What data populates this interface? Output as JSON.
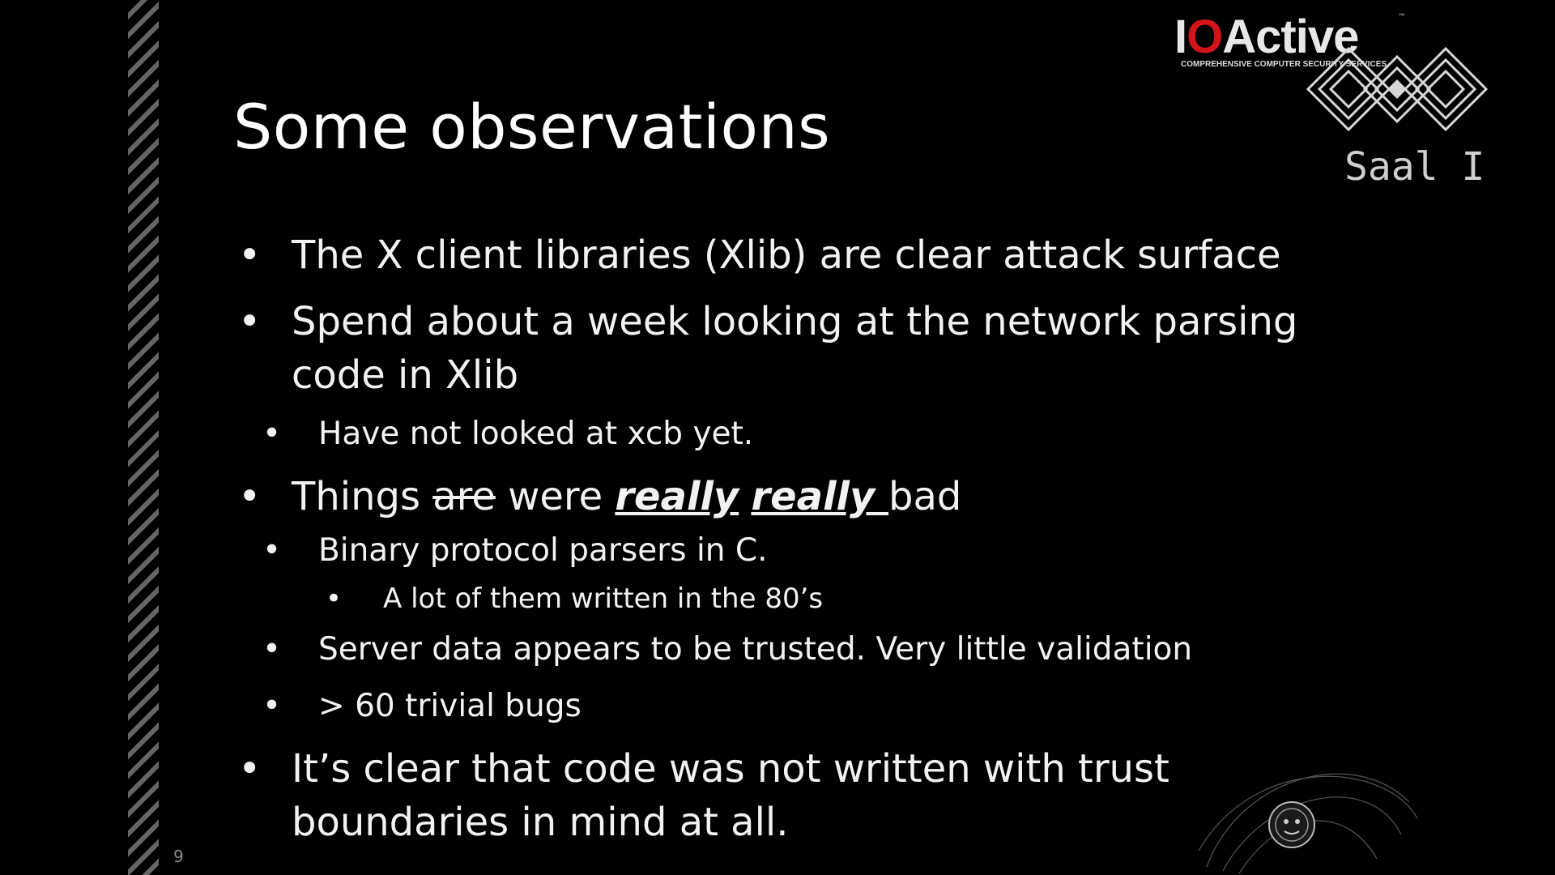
{
  "slide": {
    "title": "Some observations",
    "number": "9"
  },
  "logo": {
    "brand_prefix": "I",
    "brand_o": "O",
    "brand_suffix": "Active",
    "trademark": "™",
    "tagline": "COMPREHENSIVE COMPUTER SECURITY SERVICES"
  },
  "event": {
    "room": "Saal I"
  },
  "bullets": {
    "b1": "The X client libraries (Xlib) are clear attack surface",
    "b2_line1": "Spend about a week looking at the network parsing",
    "b2_line2": "code in Xlib",
    "b2_sub": "Have not looked at xcb yet.",
    "b3": {
      "prefix": "Things ",
      "struck": "are",
      "middle": " were ",
      "emph1": "really",
      "emph2": "really ",
      "suffix": "bad"
    },
    "b3_sub1": "Binary protocol parsers in C.",
    "b3_sub1_sub": "A lot of them written in the 80’s",
    "b3_sub2": "Server data appears to be trusted. Very little validation",
    "b3_sub3": "> 60 trivial bugs",
    "b4_line1": "It’s clear that code was not written with trust",
    "b4_line2": "boundaries in mind at all.",
    "bullet_glyph": "•"
  },
  "colors": {
    "background": "#000000",
    "text": "#f2f2f2",
    "brand_red": "#d3141b"
  },
  "icons": {
    "emblem": "saal-emblem-icon",
    "mascot": "mascot-emblem-icon"
  }
}
